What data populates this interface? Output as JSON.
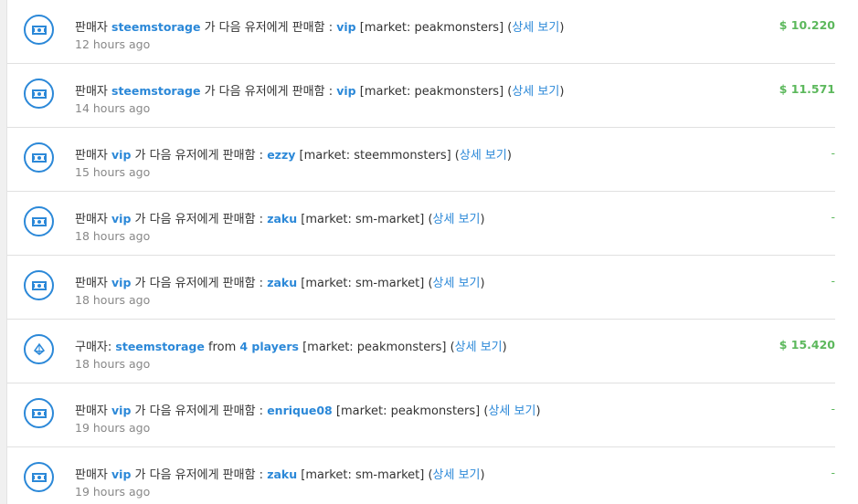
{
  "colors": {
    "accent": "#2b88d8",
    "positive": "#5cb85c"
  },
  "rows": [
    {
      "icon": "cash-icon",
      "prefix": "판매자 ",
      "user1": "steemstorage",
      "middle": " 가 다음 유저에게 판매함 : ",
      "user2": "vip",
      "market": " [market: peakmonsters] (",
      "details": "상세 보기",
      "suffix": ")",
      "time": "12 hours ago",
      "amount": "$ 10.220"
    },
    {
      "icon": "cash-icon",
      "prefix": "판매자 ",
      "user1": "steemstorage",
      "middle": " 가 다음 유저에게 판매함 : ",
      "user2": "vip",
      "market": " [market: peakmonsters] (",
      "details": "상세 보기",
      "suffix": ")",
      "time": "14 hours ago",
      "amount": "$ 11.571"
    },
    {
      "icon": "cash-icon",
      "prefix": "판매자 ",
      "user1": "vip",
      "middle": " 가 다음 유저에게 판매함 : ",
      "user2": "ezzy",
      "market": " [market: steemmonsters] (",
      "details": "상세 보기",
      "suffix": ")",
      "time": "15 hours ago",
      "amount": "-"
    },
    {
      "icon": "cash-icon",
      "prefix": "판매자 ",
      "user1": "vip",
      "middle": " 가 다음 유저에게 판매함 : ",
      "user2": "zaku",
      "market": " [market: sm-market] (",
      "details": "상세 보기",
      "suffix": ")",
      "time": "18 hours ago",
      "amount": "-"
    },
    {
      "icon": "cash-icon",
      "prefix": "판매자 ",
      "user1": "vip",
      "middle": " 가 다음 유저에게 판매함 : ",
      "user2": "zaku",
      "market": " [market: sm-market] (",
      "details": "상세 보기",
      "suffix": ")",
      "time": "18 hours ago",
      "amount": "-"
    },
    {
      "icon": "diamond-icon",
      "prefix": "구매자: ",
      "user1": "steemstorage",
      "middle": " from ",
      "user2": "4 players",
      "market": " [market: peakmonsters] (",
      "details": "상세 보기",
      "suffix": ")",
      "time": "18 hours ago",
      "amount": "$ 15.420"
    },
    {
      "icon": "cash-icon",
      "prefix": "판매자 ",
      "user1": "vip",
      "middle": " 가 다음 유저에게 판매함 : ",
      "user2": "enrique08",
      "market": " [market: peakmonsters] (",
      "details": "상세 보기",
      "suffix": ")",
      "time": "19 hours ago",
      "amount": "-"
    },
    {
      "icon": "cash-icon",
      "prefix": "판매자 ",
      "user1": "vip",
      "middle": " 가 다음 유저에게 판매함 : ",
      "user2": "zaku",
      "market": " [market: sm-market] (",
      "details": "상세 보기",
      "suffix": ")",
      "time": "19 hours ago",
      "amount": "-"
    }
  ]
}
